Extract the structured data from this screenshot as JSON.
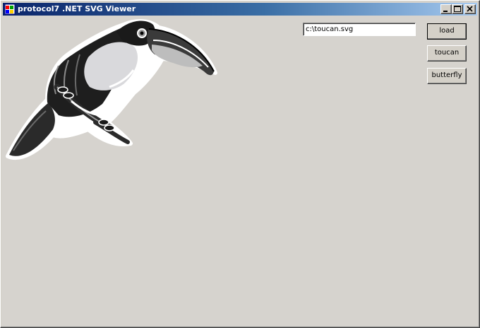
{
  "window": {
    "title": "protocol7 .NET SVG Viewer",
    "app_icon": "windows-app-icon",
    "controls": {
      "minimize_icon": "minimize-icon",
      "maximize_icon": "maximize-icon",
      "close_icon": "close-icon"
    }
  },
  "toolbar": {
    "path_value": "c:\\toucan.svg",
    "load_label": "load",
    "toucan_label": "toucan",
    "butterfly_label": "butterfly"
  },
  "viewer": {
    "image_subject": "toucan-illustration"
  }
}
